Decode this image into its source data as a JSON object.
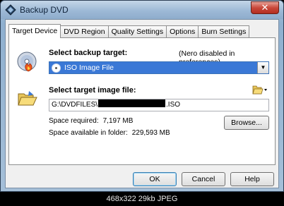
{
  "window": {
    "title": "Backup DVD",
    "close_glyph": "✕",
    "app_icon": "dvd-app-icon"
  },
  "tabs": [
    {
      "label": "Target Device",
      "active": true
    },
    {
      "label": "DVD Region",
      "active": false
    },
    {
      "label": "Quality Settings",
      "active": false
    },
    {
      "label": "Options",
      "active": false
    },
    {
      "label": "Burn Settings",
      "active": false
    }
  ],
  "target": {
    "heading": "Select backup target:",
    "note": "(Nero disabled in preferences)",
    "selected_option": "ISO Image File",
    "icon": "cd-burn-icon"
  },
  "image_file": {
    "heading": "Select target image file:",
    "path_prefix": "G:\\DVDFILES\\",
    "path_suffix": ".ISO",
    "icon": "folder-open-icon"
  },
  "space": {
    "required_label": "Space required:",
    "required_value": "7,197 MB",
    "available_label": "Space available in folder:",
    "available_value": "229,593 MB"
  },
  "buttons": {
    "browse": "Browse...",
    "ok": "OK",
    "cancel": "Cancel",
    "help": "Help"
  },
  "footer": {
    "caption": "468x322 29kb JPEG"
  },
  "colors": {
    "selection": "#3a78d6",
    "close_button": "#c9483a"
  }
}
